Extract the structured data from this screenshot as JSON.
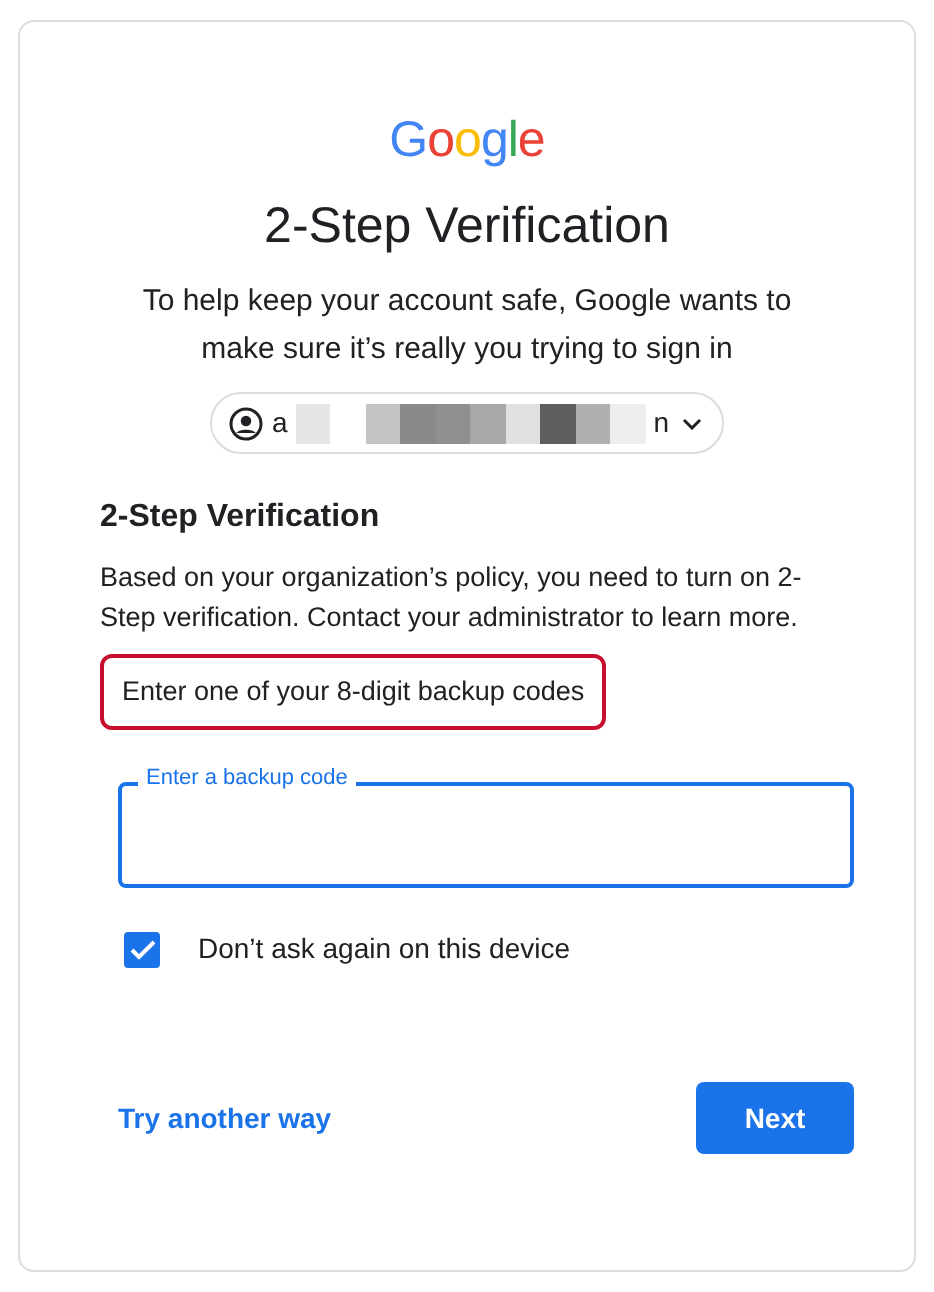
{
  "logo": [
    {
      "char": "G",
      "color": "#4285f4"
    },
    {
      "char": "o",
      "color": "#ea4335"
    },
    {
      "char": "o",
      "color": "#fbbc05"
    },
    {
      "char": "g",
      "color": "#4285f4"
    },
    {
      "char": "l",
      "color": "#34a853"
    },
    {
      "char": "e",
      "color": "#ea4335"
    }
  ],
  "title": "2-Step Verification",
  "subtitle": "To help keep your account safe, Google wants to make sure it’s really you trying to sign in",
  "account_chip": {
    "text_start": "a",
    "text_end": "n",
    "redacted": true
  },
  "section_heading": "2-Step Verification",
  "policy_text": "Based on your organization’s policy, you need to turn on 2-Step verification. Contact your administrator to learn more.",
  "instruction": {
    "text": "Enter one of your 8-digit backup codes",
    "highlighted": true
  },
  "code_field": {
    "label": "Enter a backup code",
    "focused": true
  },
  "remember_checkbox": {
    "label": "Don’t ask again on this device",
    "checked": true
  },
  "alt_link": "Try another way",
  "next_button": "Next"
}
